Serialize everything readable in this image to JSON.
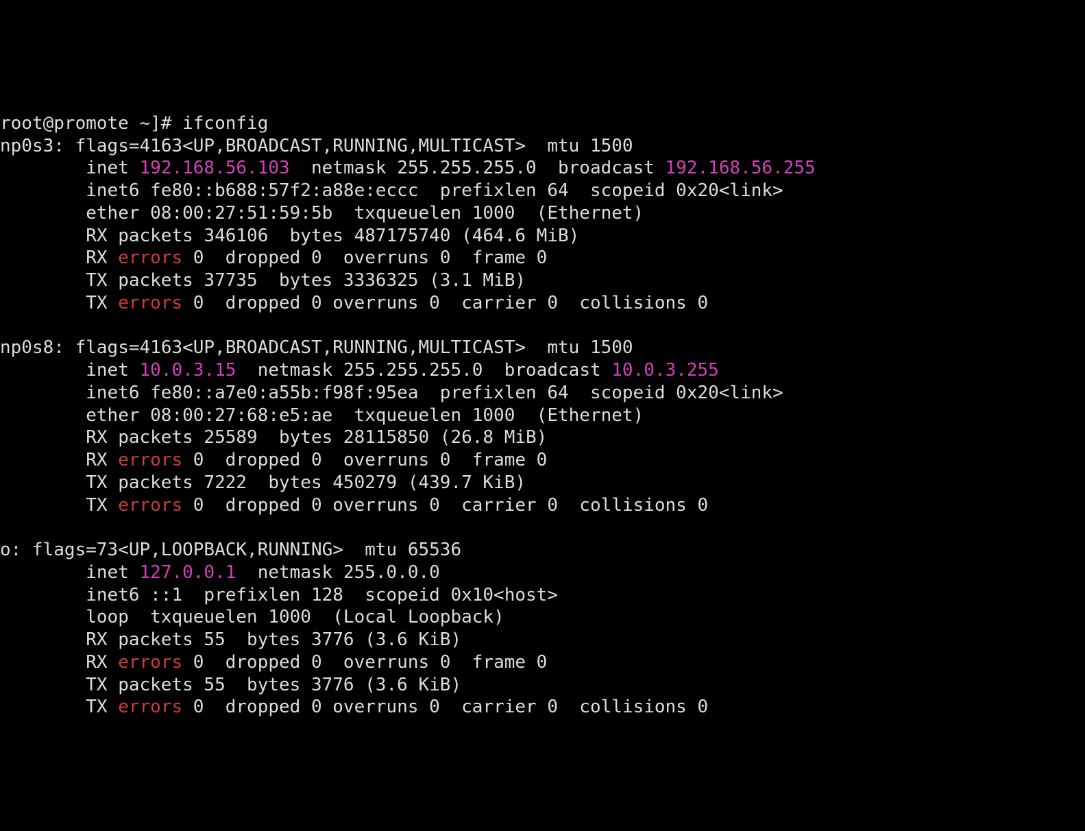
{
  "prompt": {
    "user_host": "root@promote",
    "path": "~",
    "symbol": "]#",
    "command": "ifconfig"
  },
  "interfaces": [
    {
      "name": "np0s3",
      "flags": "flags=4163<UP,BROADCAST,RUNNING,MULTICAST>",
      "mtu": "mtu 1500",
      "inet_prefix": "inet ",
      "inet_ip": "192.168.56.103",
      "inet_rest": "  netmask 255.255.255.0  broadcast ",
      "inet_bcast": "192.168.56.255",
      "inet6": "inet6 fe80::b688:57f2:a88e:eccc  prefixlen 64  scopeid 0x20<link>",
      "ether": "ether 08:00:27:51:59:5b  txqueuelen 1000  (Ethernet)",
      "rx_packets": "RX packets 346106  bytes 487175740 (464.6 MiB)",
      "rx_err1": "RX ",
      "rx_errword": "errors",
      "rx_err2": " 0  dropped 0  overruns 0  frame 0",
      "tx_packets": "TX packets 37735  bytes 3336325 (3.1 MiB)",
      "tx_err1": "TX ",
      "tx_errword": "errors",
      "tx_err2": " 0  dropped 0 overruns 0  carrier 0  collisions 0"
    },
    {
      "name": "np0s8",
      "flags": "flags=4163<UP,BROADCAST,RUNNING,MULTICAST>",
      "mtu": "mtu 1500",
      "inet_prefix": "inet ",
      "inet_ip": "10.0.3.15",
      "inet_rest": "  netmask 255.255.255.0  broadcast ",
      "inet_bcast": "10.0.3.255",
      "inet6": "inet6 fe80::a7e0:a55b:f98f:95ea  prefixlen 64  scopeid 0x20<link>",
      "ether": "ether 08:00:27:68:e5:ae  txqueuelen 1000  (Ethernet)",
      "rx_packets": "RX packets 25589  bytes 28115850 (26.8 MiB)",
      "rx_err1": "RX ",
      "rx_errword": "errors",
      "rx_err2": " 0  dropped 0  overruns 0  frame 0",
      "tx_packets": "TX packets 7222  bytes 450279 (439.7 KiB)",
      "tx_err1": "TX ",
      "tx_errword": "errors",
      "tx_err2": " 0  dropped 0 overruns 0  carrier 0  collisions 0"
    },
    {
      "name": "o",
      "flags": "flags=73<UP,LOOPBACK,RUNNING>",
      "mtu": "mtu 65536",
      "inet_prefix": "inet ",
      "inet_ip": "127.0.0.1",
      "inet_rest": "  netmask 255.0.0.0",
      "inet_bcast": "",
      "inet6": "inet6 ::1  prefixlen 128  scopeid 0x10<host>",
      "ether": "loop  txqueuelen 1000  (Local Loopback)",
      "rx_packets": "RX packets 55  bytes 3776 (3.6 KiB)",
      "rx_err1": "RX ",
      "rx_errword": "errors",
      "rx_err2": " 0  dropped 0  overruns 0  frame 0",
      "tx_packets": "TX packets 55  bytes 3776 (3.6 KiB)",
      "tx_err1": "TX ",
      "tx_errword": "errors",
      "tx_err2": " 0  dropped 0 overruns 0  carrier 0  collisions 0"
    }
  ],
  "indent": "        "
}
